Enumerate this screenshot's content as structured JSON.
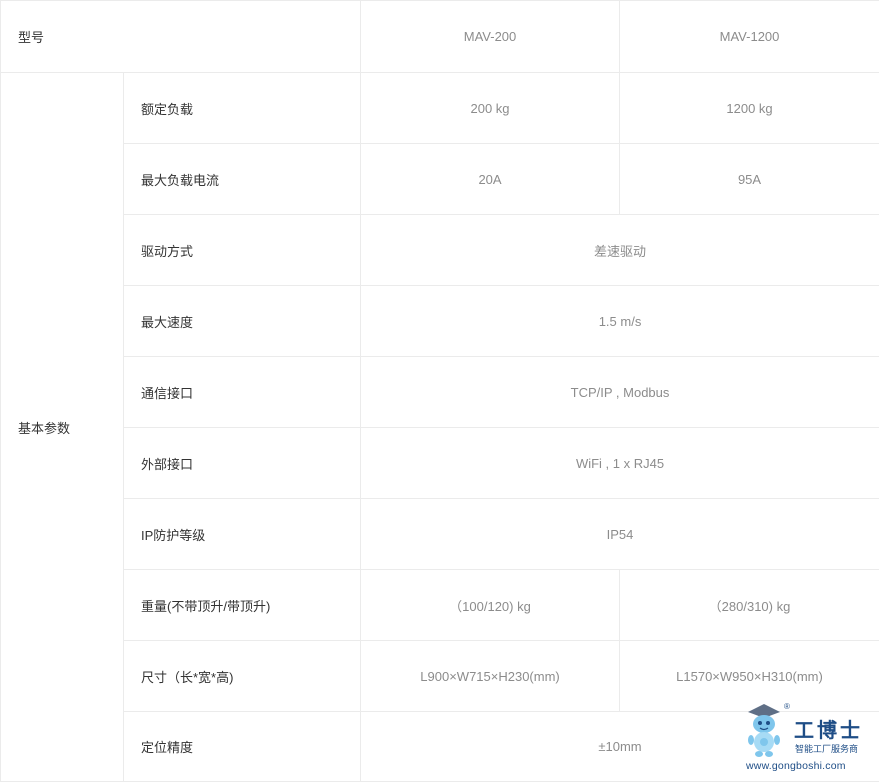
{
  "table": {
    "header": {
      "label": "型号",
      "models": [
        "MAV-200",
        "MAV-1200"
      ]
    },
    "group_label": "基本参数",
    "rows": [
      {
        "label": "额定负载",
        "values": [
          "200 kg",
          "1200 kg"
        ]
      },
      {
        "label": "最大负载电流",
        "values": [
          "20A",
          "95A"
        ]
      },
      {
        "label": "驱动方式",
        "shared": "差速驱动"
      },
      {
        "label": "最大速度",
        "shared": "1.5 m/s"
      },
      {
        "label": "通信接口",
        "shared": "TCP/IP , Modbus"
      },
      {
        "label": "外部接口",
        "shared": "WiFi , 1 x RJ45"
      },
      {
        "label": "IP防护等级",
        "shared": "IP54"
      },
      {
        "label": "重量(不带顶升/带顶升)",
        "values": [
          "（100/120) kg",
          "（280/310) kg"
        ]
      },
      {
        "label": "尺寸（长*宽*高)",
        "values": [
          "L900×W715×H230(mm)",
          "L1570×W950×H310(mm)"
        ]
      },
      {
        "label": "定位精度",
        "shared": "±10mm"
      }
    ]
  },
  "watermark": {
    "title": "工博士",
    "registered": "®",
    "subtitle": "智能工厂服务商",
    "url": "www.gongboshi.com"
  }
}
